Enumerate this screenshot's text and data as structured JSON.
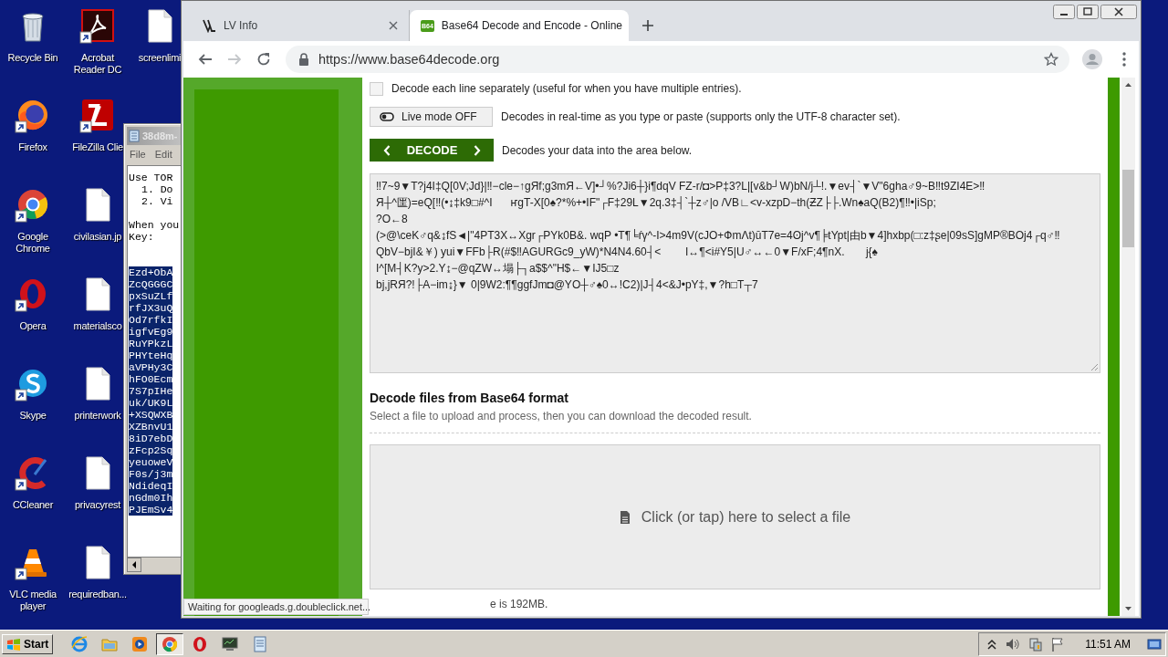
{
  "desktop": {
    "columns": [
      [
        {
          "kind": "recycle",
          "label": "Recycle Bin",
          "shortcut": false
        },
        {
          "kind": "firefox",
          "label": "Firefox",
          "shortcut": true
        },
        {
          "kind": "chrome",
          "label": "Google Chrome",
          "shortcut": true
        },
        {
          "kind": "opera",
          "label": "Opera",
          "shortcut": true
        },
        {
          "kind": "skype",
          "label": "Skype",
          "shortcut": true
        },
        {
          "kind": "ccleaner",
          "label": "CCleaner",
          "shortcut": true
        },
        {
          "kind": "vlc",
          "label": "VLC media player",
          "shortcut": true
        }
      ],
      [
        {
          "kind": "acrobat",
          "label": "Acrobat Reader DC",
          "shortcut": true
        },
        {
          "kind": "filezilla",
          "label": "FileZilla Clie",
          "shortcut": true
        },
        {
          "kind": "file",
          "label": "civilasian.jp",
          "shortcut": false
        },
        {
          "kind": "file",
          "label": "materialsco",
          "shortcut": false
        },
        {
          "kind": "file",
          "label": "printerwork",
          "shortcut": false
        },
        {
          "kind": "file",
          "label": "privacyrest",
          "shortcut": false
        },
        {
          "kind": "file",
          "label": "requiredban...",
          "shortcut": false
        }
      ],
      [
        {
          "kind": "file",
          "label": "screenlimi",
          "shortcut": false
        }
      ]
    ]
  },
  "notepad": {
    "title": "38d8m-",
    "menu": [
      "File",
      "Edit"
    ],
    "intro_lines": [
      {
        "text": "Use TOR",
        "kind": "plain"
      },
      {
        "text": "1. Do",
        "kind": "step"
      },
      {
        "text": "2. Vi",
        "kind": "step"
      }
    ],
    "key_lines": [
      "When you",
      "Key:"
    ],
    "selected_lines": [
      "Ezd+ObA",
      "ZcQGGGC",
      "pxSuZLf",
      "rfJX3uQ",
      "Od7rfkI",
      "igfvEg9",
      "RuYPkzL",
      "PHYteHq",
      "aVPHy3C",
      "hFO0Ecm",
      "7S7pIHe",
      "uk/UK9L",
      "+XSQWXB",
      "XZBnvU1",
      "8iD7ebD",
      "zFcp2Sq",
      "yeuoweV",
      "F0s/j3m",
      "NdideqI",
      "nGdm0Ih",
      "PJEmSv4"
    ]
  },
  "browser": {
    "tabs": [
      {
        "title": "LV Info",
        "kind": "logo",
        "selected": false
      },
      {
        "title": "Base64 Decode and Encode - Online",
        "kind": "badge",
        "badge": "B64",
        "selected": true
      }
    ],
    "nav": {
      "forward_disabled": true
    },
    "url": "https://www.base64decode.org",
    "page": {
      "line_option": {
        "label": "Decode each line separately (useful for when you have multiple entries).",
        "checked": false
      },
      "live_mode": {
        "label": "Live mode OFF",
        "description": "Decodes in real-time as you type or paste (supports only the UTF-8 character set)."
      },
      "decode": {
        "label": "DECODE",
        "description": "Decodes your data into the area below."
      },
      "output_lines": [
        "‼7~9▼T?j4I‡Q[0V;Jd}|‼−cle−↑gЯf;g3mЯ←V]•┘%?Ji6┼}i¶dqV FZ-r/◘>P‡3?L|[v&b┘W)bN/j┴!.▼ev┤`▼V\"6gha♂9~B‼t9ZI4E>‼",
        "Я┼^匩)=eQ[‼(•↨‡k9□#^I      ҥgT-X[0♠?*%+•IF\"┌F‡29L▼2q.3‡┤`┼z♂|o /VB∟<v-xzpD−th(ƵZ├├.Wn♠aQ(B2)¶‼•|iSp;",
        "?O←8",
        "(>@\\ceK♂q&↨fS◄|\"4PT3X↔Xgr┌PYk0B&. wqP •T¶╘ŕγ^-I>4m9V(cJO+ФmΛt)ūT7e=4ʘj^v¶╞tYpt|由b▼4]hxbp(□:z‡ʂe|09sS]gMP®BOj4┌q♂‼",
        "QbV−bjI&￥) yui▼FFb├R(#$‼AGURGc9_yW)*N4N4.60┤<        I↔¶<i#Y5|U♂↔←0▼F/xF;4¶nX.       j{♠",
        "I^[M┤K?y>2.Y↨−@qZW↔塌├┐a$$^\"H$←▼IJ5□z",
        "bj,jRЯ?!├A−im↨}▼ 0|9W2:¶¶ggfJm◘@YO┼♂♠0↔!C2)|J┤4<&J•pY‡,▼?h□T┬7"
      ],
      "files": {
        "heading": "Decode files from Base64 format",
        "subtitle": "Select a file to upload and process, then you can download the decoded result.",
        "dropzone": "Click (or tap) here to select a file",
        "footer": "e is 192MB."
      }
    },
    "status": "Waiting for googleads.g.doubleclick.net..."
  },
  "taskbar": {
    "start": "Start",
    "items": [
      {
        "kind": "ie",
        "selected": false
      },
      {
        "kind": "folder",
        "selected": false
      },
      {
        "kind": "media",
        "selected": false
      },
      {
        "kind": "chrome",
        "selected": true
      },
      {
        "kind": "opera",
        "selected": false
      },
      {
        "kind": "monitor",
        "selected": false
      },
      {
        "kind": "notepad",
        "selected": false
      }
    ],
    "clock": "11:51 AM"
  }
}
